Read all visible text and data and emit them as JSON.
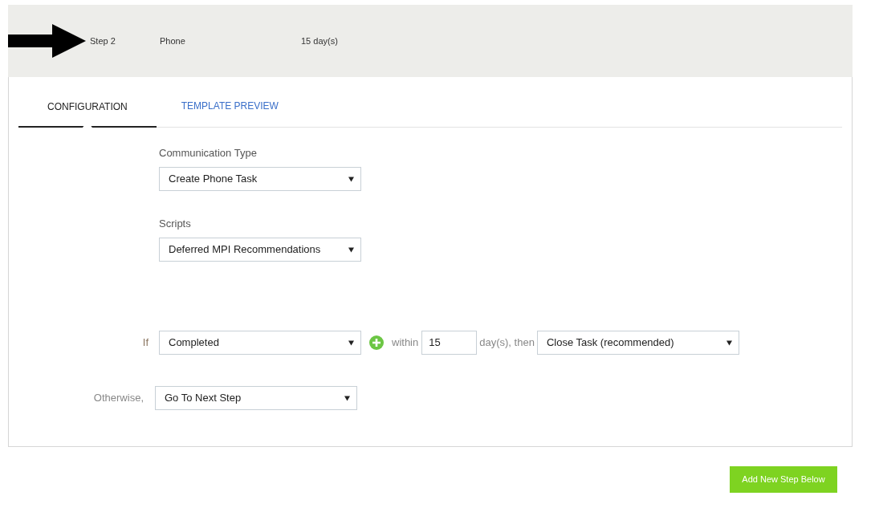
{
  "step_header": {
    "step": "Step 2",
    "channel": "Phone",
    "delay": "15 day(s)"
  },
  "tabs": [
    {
      "label": "CONFIGURATION",
      "selected": true
    },
    {
      "label": "TEMPLATE PREVIEW",
      "selected": false
    }
  ],
  "fields": [
    {
      "label": "Communication Type",
      "value": "Create Phone Task"
    },
    {
      "label": "Scripts",
      "value": "Deferred MPI Recommendations"
    }
  ],
  "condition": {
    "if_label": "If",
    "status": "Completed",
    "within_label": "within",
    "days": "15",
    "then_label": "day(s), then",
    "action": "Close Task (recommended)"
  },
  "otherwise": {
    "label": "Otherwise,",
    "action": "Go To Next Step"
  },
  "add_button": "Add New Step Below"
}
